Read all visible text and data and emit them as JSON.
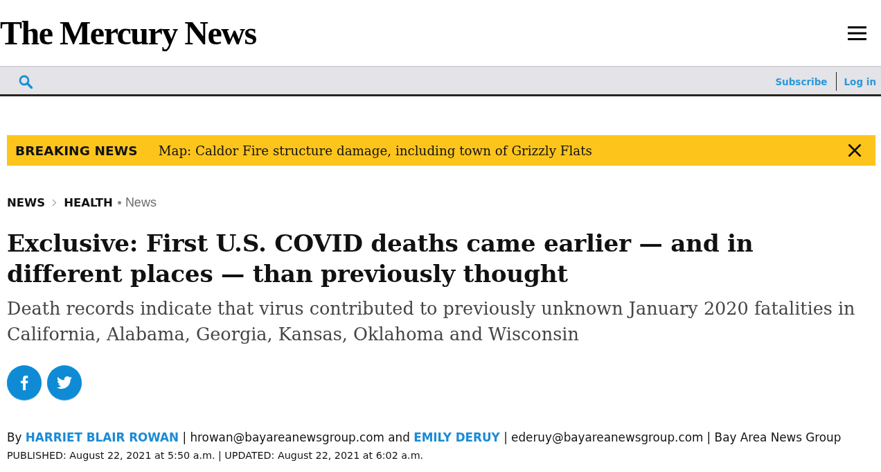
{
  "header": {
    "logo": "The Mercury News"
  },
  "nav": {
    "links": [
      "Subscribe",
      "Log in"
    ]
  },
  "breaking_news": {
    "label": "BREAKING NEWS",
    "headline": "Map: Caldor Fire structure damage, including town of Grizzly Flats"
  },
  "breadcrumb": {
    "items": [
      "NEWS",
      "HEALTH"
    ],
    "tag": "News"
  },
  "article": {
    "headline": "Exclusive: First U.S. COVID deaths came earlier — and in different places — than previously thought",
    "subheadline": "Death records indicate that virus contributed to previously unknown January 2020 fatalities in California, Alabama, Georgia, Kansas, Oklahoma and Wisconsin",
    "share_buttons": [
      {
        "kind": "facebook"
      },
      {
        "kind": "twitter"
      }
    ],
    "byline": [
      {
        "kind": "text",
        "text": "By"
      },
      {
        "kind": "link",
        "text": "HARRIET BLAIR ROWAN"
      },
      {
        "kind": "text",
        "text": "| hrowan@bayareanewsgroup.com and"
      },
      {
        "kind": "link",
        "text": "EMILY DERUY"
      },
      {
        "kind": "text",
        "text": "| ederuy@bayareanewsgroup.com | Bay Area News Group"
      }
    ],
    "published": "PUBLISHED: August 22, 2021 at 5:50 a.m. | UPDATED: August 22, 2021 at 6:02 a.m."
  }
}
